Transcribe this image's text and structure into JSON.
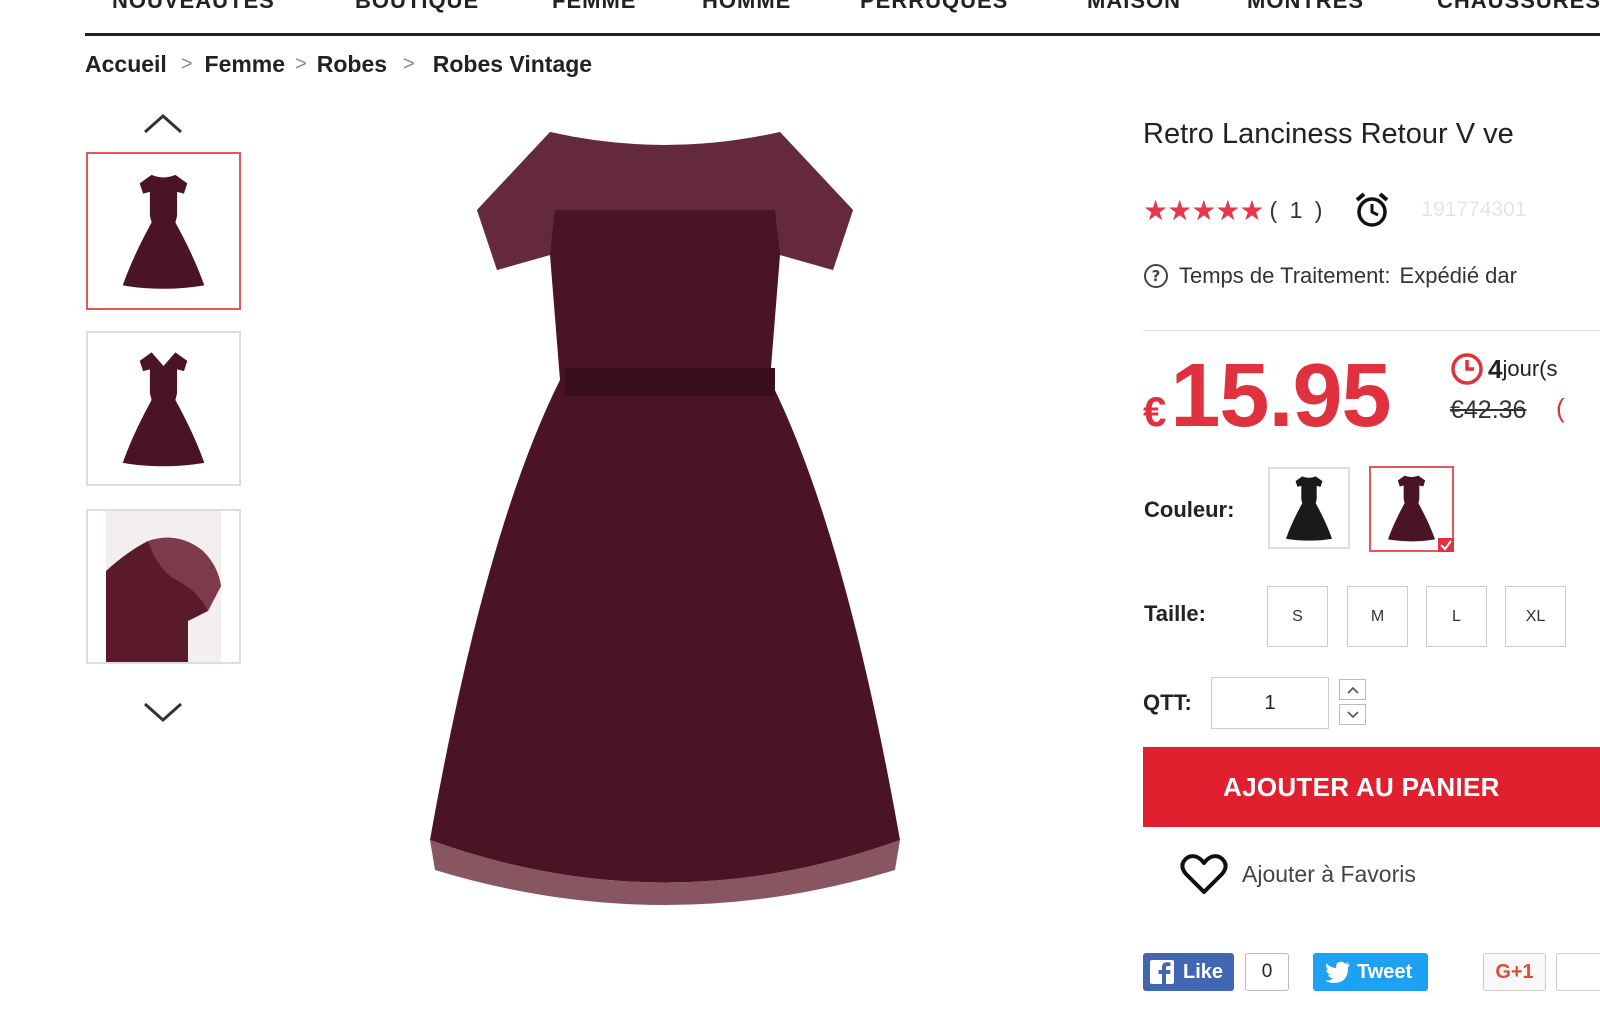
{
  "nav": {
    "items": [
      "NOUVEAUTÉS",
      "BOUTIQUE",
      "FEMME",
      "HOMME",
      "PERRUQUES",
      "MAISON",
      "MONTRES",
      "CHAUSSURES"
    ]
  },
  "breadcrumb": {
    "items": [
      "Accueil",
      "Femme",
      "Robes",
      "Robes Vintage"
    ],
    "separator": ">"
  },
  "product": {
    "title": "Retro Lanciness Retour V ve",
    "stars": "★★★★★",
    "rating_count": "( 1 )",
    "sku": "191774301",
    "processing_label": "Temps de Traitement:",
    "processing_value": "Expédié dar",
    "currency": "€",
    "price": "15.95",
    "countdown_days": "4",
    "countdown_unit": "jour(s",
    "old_price": "€42.36",
    "discount": "(",
    "color_label": "Couleur:",
    "size_label": "Taille:",
    "sizes": [
      "S",
      "M",
      "L",
      "XL"
    ],
    "qty_label": "QTT:",
    "qty_value": "1",
    "add_to_cart": "AJOUTER AU PANIER",
    "favorites": "Ajouter à Favoris"
  },
  "social": {
    "fb_like": "Like",
    "fb_count": "0",
    "tweet": "Tweet",
    "gplus": "G+1"
  },
  "colors": {
    "accent_red": "#e0313f",
    "button_red": "#e0202f",
    "dress_burgundy": "#4a1424",
    "dress_black": "#1a1a1a",
    "facebook_blue": "#4267b2",
    "twitter_blue": "#1da1f2"
  }
}
